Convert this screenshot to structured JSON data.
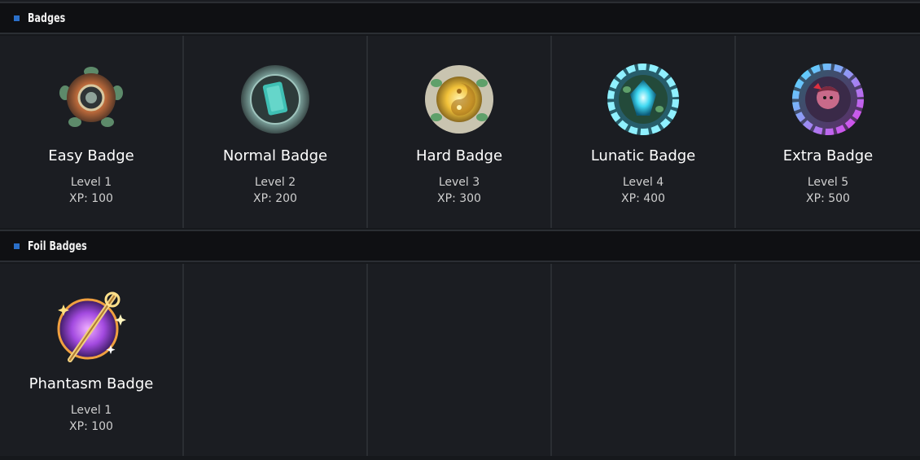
{
  "sections": [
    {
      "title": "Badges",
      "badges": [
        {
          "name": "Easy Badge",
          "level": "Level 1",
          "xp": "XP: 100",
          "icon": "easy-badge-icon",
          "color": "#d98a4a"
        },
        {
          "name": "Normal Badge",
          "level": "Level 2",
          "xp": "XP: 200",
          "icon": "normal-badge-icon",
          "color": "#4fd0c8"
        },
        {
          "name": "Hard Badge",
          "level": "Level 3",
          "xp": "XP: 300",
          "icon": "hard-badge-icon",
          "color": "#f2c23a"
        },
        {
          "name": "Lunatic Badge",
          "level": "Level 4",
          "xp": "XP: 400",
          "icon": "lunatic-badge-icon",
          "color": "#3fd8f2"
        },
        {
          "name": "Extra Badge",
          "level": "Level 5",
          "xp": "XP: 500",
          "icon": "extra-badge-icon",
          "color": "#d24ad8"
        }
      ]
    },
    {
      "title": "Foil Badges",
      "badges": [
        {
          "name": "Phantasm Badge",
          "level": "Level 1",
          "xp": "XP: 100",
          "icon": "phantasm-badge-icon",
          "color": "#a34ae0"
        }
      ]
    }
  ]
}
